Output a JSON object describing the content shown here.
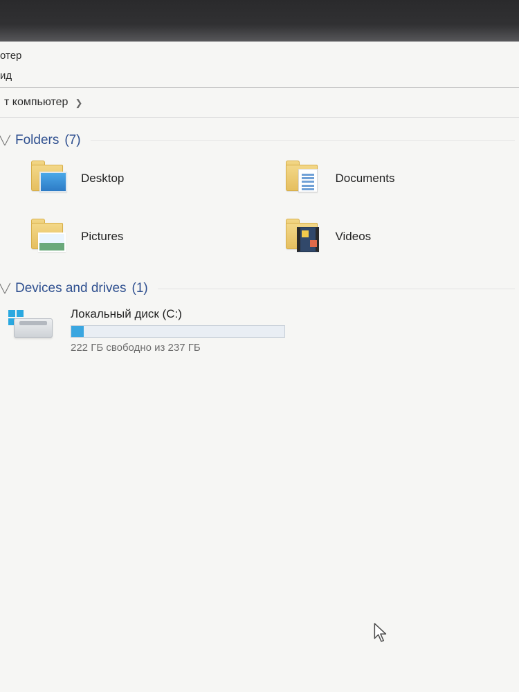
{
  "titlebar": {
    "title_fragment": "отер"
  },
  "menubar": {
    "view_fragment": "ид"
  },
  "breadcrumb": {
    "location_fragment": "т компьютер"
  },
  "groups": {
    "folders": {
      "label": "Folders",
      "count": "(7)"
    },
    "drives": {
      "label": "Devices and drives",
      "count": "(1)"
    }
  },
  "folders": [
    {
      "name": "Desktop",
      "icon": "desktop"
    },
    {
      "name": "Documents",
      "icon": "documents"
    },
    {
      "name": "Pictures",
      "icon": "pictures"
    },
    {
      "name": "Videos",
      "icon": "videos"
    }
  ],
  "drive": {
    "name": "Локальный диск (C:)",
    "free_text": "222 ГБ свободно из 237 ГБ",
    "used_percent": 6
  }
}
